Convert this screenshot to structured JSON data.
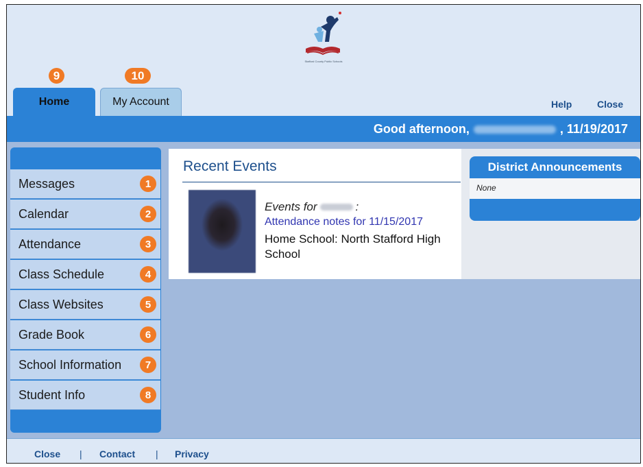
{
  "header": {
    "logo_text": "Stafford County Public Schools",
    "tabs": [
      {
        "label": "Home",
        "badge": "9"
      },
      {
        "label": "My Account",
        "badge": "10"
      }
    ],
    "links": {
      "help": "Help",
      "close": "Close"
    },
    "greeting_prefix": "Good afternoon,",
    "greeting_date": ", 11/19/2017"
  },
  "sidebar": {
    "items": [
      {
        "label": "Messages",
        "badge": "1"
      },
      {
        "label": "Calendar",
        "badge": "2"
      },
      {
        "label": "Attendance",
        "badge": "3"
      },
      {
        "label": "Class Schedule",
        "badge": "4"
      },
      {
        "label": "Class Websites",
        "badge": "5"
      },
      {
        "label": "Grade Book",
        "badge": "6"
      },
      {
        "label": "School Information",
        "badge": "7"
      },
      {
        "label": "Student Info",
        "badge": "8"
      }
    ]
  },
  "events": {
    "title": "Recent Events",
    "for_label": "Events for",
    "for_suffix": ":",
    "link": "Attendance notes for 11/15/2017",
    "school": "Home School: North Stafford High School"
  },
  "announcements": {
    "title": "District Announcements",
    "body": "None"
  },
  "footer": {
    "close": "Close",
    "contact": "Contact",
    "privacy": "Privacy",
    "separator": "|"
  },
  "colors": {
    "primary_blue": "#2b82d6",
    "badge_orange": "#f07a25",
    "light_bg": "#dde8f6",
    "link_blue": "#1d4f8c"
  }
}
